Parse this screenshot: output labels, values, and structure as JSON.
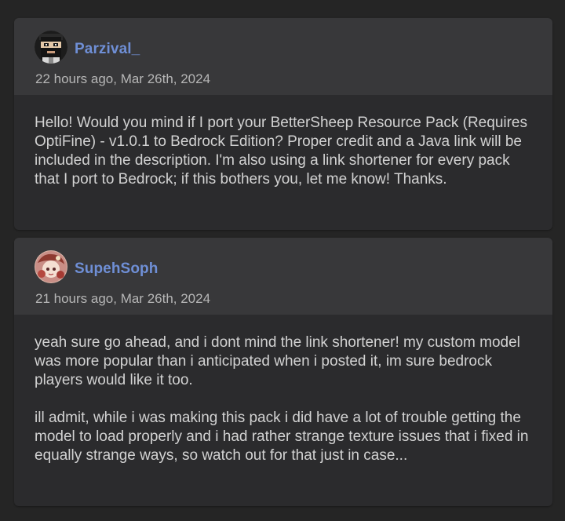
{
  "comments": [
    {
      "author": "Parzival_",
      "timestamp": "22 hours ago, Mar 26th, 2024",
      "avatar_icon": "pixel-bearded-man-avatar",
      "paragraphs": [
        "Hello! Would you mind if I port your BetterSheep Resource Pack (Requires OptiFine) - v1.0.1 to Bedrock Edition? Proper credit and a Java link will be included in the description. I'm also using a link shortener for every pack that I port to Bedrock; if this bothers you, let me know! Thanks."
      ]
    },
    {
      "author": "SupehSoph",
      "timestamp": "21 hours ago, Mar 26th, 2024",
      "avatar_icon": "anime-character-avatar",
      "paragraphs": [
        "yeah sure go ahead, and i dont mind the link shortener! my custom model was more popular than i anticipated when i posted it, im sure bedrock players would like it too.",
        "ill admit, while i was making this pack i did have a lot of trouble getting the model to load properly and i had rather strange texture issues that i fixed in equally strange ways, so watch out for that just in case..."
      ]
    }
  ],
  "colors": {
    "page_background": "#252525",
    "card_header": "#38383a",
    "card_body": "#2b2b2d",
    "username": "#6f8fd6",
    "timestamp": "#b6b6b6",
    "body_text": "#d2d2d2"
  }
}
